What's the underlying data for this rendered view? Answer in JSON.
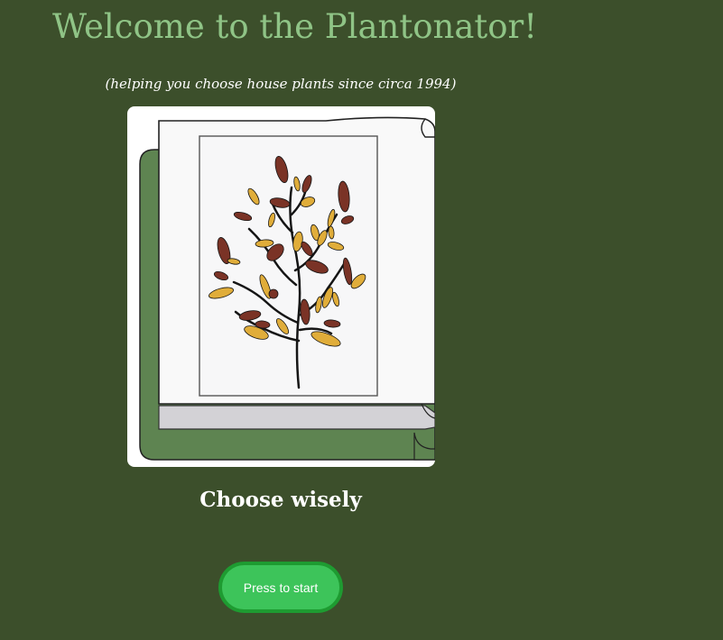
{
  "header": {
    "title": "Welcome to the Plantonator!",
    "subtitle": "(helping you choose house plants since circa 1994)"
  },
  "hero": {
    "image": "book-with-autumn-tree-illustration"
  },
  "tagline": "Choose wisely",
  "start_button": {
    "label": "Press to start"
  },
  "colors": {
    "background": "#3c4f2b",
    "title": "#8fc486",
    "button_fill": "#3dc45a",
    "button_border": "#1e9b31",
    "book_cover": "#5e8451",
    "leaf_dark": "#7a3326",
    "leaf_gold": "#e0ad3a"
  }
}
